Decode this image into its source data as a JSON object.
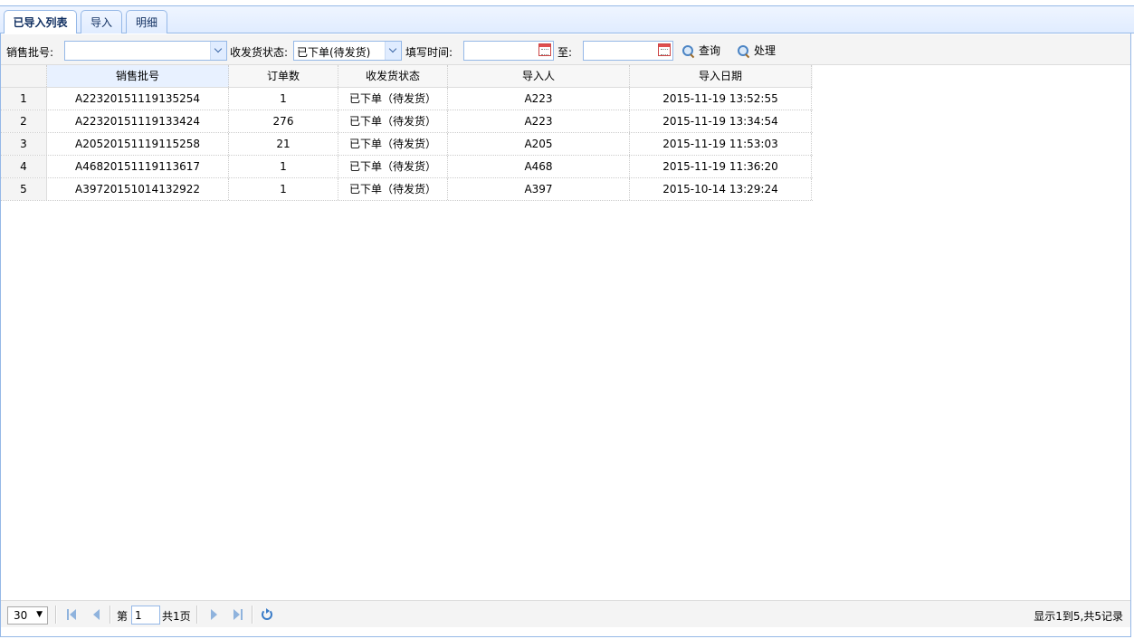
{
  "tabs": [
    {
      "label": "已导入列表",
      "active": true
    },
    {
      "label": "导入",
      "active": false
    },
    {
      "label": "明细",
      "active": false
    }
  ],
  "toolbar": {
    "batch_label": "销售批号:",
    "batch_value": "",
    "status_label": "收发货状态:",
    "status_value": "已下单(待发货)",
    "time_label": "填写时间:",
    "time_from_value": "",
    "to_label": "至:",
    "time_to_value": "",
    "query_label": "查询",
    "process_label": "处理"
  },
  "grid": {
    "columns": [
      "销售批号",
      "订单数",
      "收发货状态",
      "导入人",
      "导入日期"
    ],
    "rows": [
      {
        "num": "1",
        "batch": "A22320151119135254",
        "orders": "1",
        "status": "已下单（待发货）",
        "importer": "A223",
        "date": "2015-11-19 13:52:55"
      },
      {
        "num": "2",
        "batch": "A22320151119133424",
        "orders": "276",
        "status": "已下单（待发货）",
        "importer": "A223",
        "date": "2015-11-19 13:34:54"
      },
      {
        "num": "3",
        "batch": "A20520151119115258",
        "orders": "21",
        "status": "已下单（待发货）",
        "importer": "A205",
        "date": "2015-11-19 11:53:03"
      },
      {
        "num": "4",
        "batch": "A46820151119113617",
        "orders": "1",
        "status": "已下单（待发货）",
        "importer": "A468",
        "date": "2015-11-19 11:36:20"
      },
      {
        "num": "5",
        "batch": "A39720151014132922",
        "orders": "1",
        "status": "已下单（待发货）",
        "importer": "A397",
        "date": "2015-10-14 13:29:24"
      }
    ]
  },
  "pager": {
    "page_size": "30",
    "page_prefix": "第",
    "current_page": "1",
    "total_pages": "共1页",
    "summary": "显示1到5,共5记录"
  }
}
